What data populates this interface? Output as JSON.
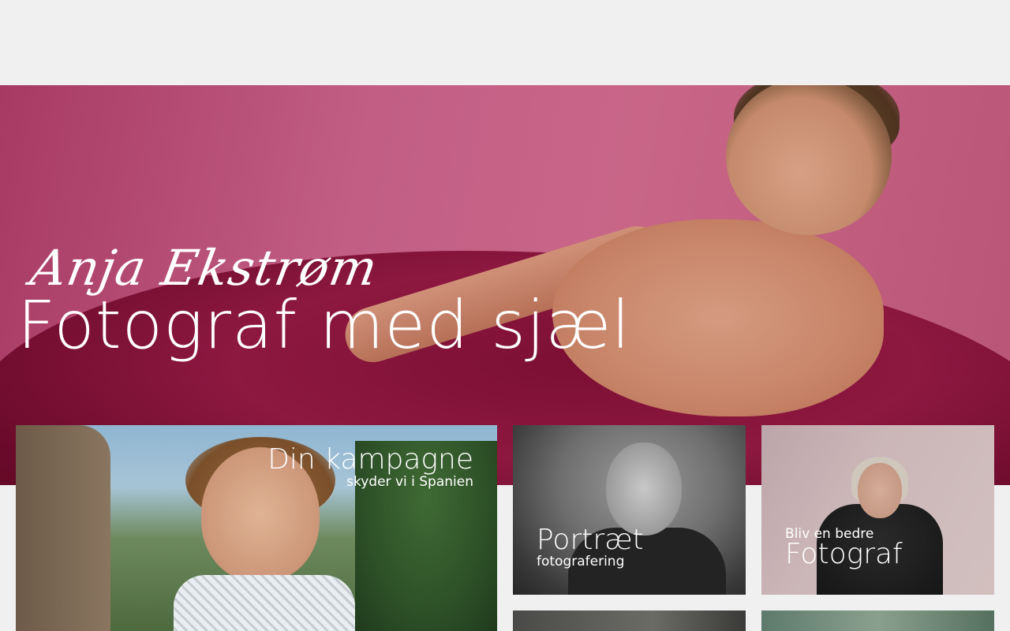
{
  "hero": {
    "signature": "Anja Ekstrøm",
    "headline": "Fotograf med sjæl"
  },
  "cards": {
    "campaign": {
      "title": "Din kampagne",
      "subtitle": "skyder vi i Spanien"
    },
    "portrait": {
      "title": "Portræt",
      "subtitle": "fotografering"
    },
    "photographer": {
      "pretitle": "Bliv en bedre",
      "title": "Fotograf"
    }
  }
}
